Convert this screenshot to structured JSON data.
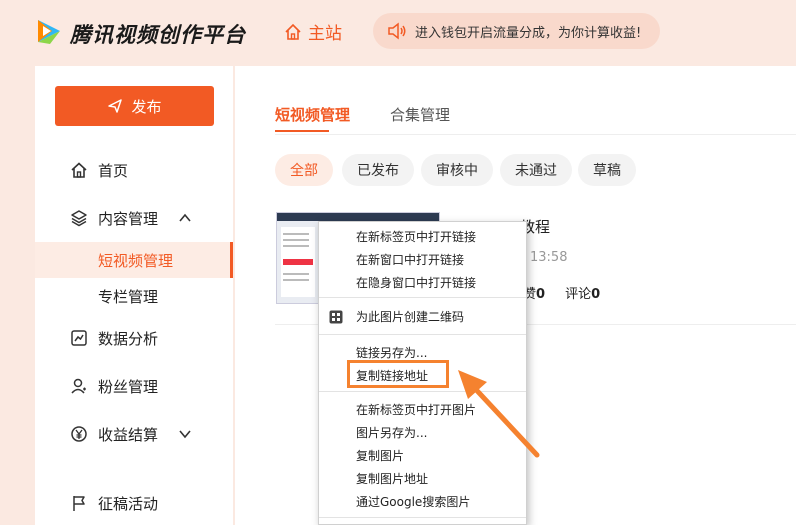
{
  "header": {
    "brand": "腾讯视频创作平台",
    "home_label": "主站",
    "notice": "进入钱包开启流量分成，为你计算收益!",
    "logo_icon": "tencent-video-logo",
    "home_icon": "home-icon",
    "speaker_icon": "speaker-icon"
  },
  "sidebar": {
    "publish_label": "发布",
    "items": [
      {
        "label": "首页",
        "icon": "home-icon"
      },
      {
        "label": "内容管理",
        "icon": "layers-icon"
      },
      {
        "label": "短视频管理"
      },
      {
        "label": "专栏管理"
      },
      {
        "label": "数据分析",
        "icon": "chart-icon"
      },
      {
        "label": "粉丝管理",
        "icon": "fans-icon"
      },
      {
        "label": "收益结算",
        "icon": "yuan-icon"
      },
      {
        "label": "征稿活动",
        "icon": "flag-icon"
      }
    ]
  },
  "main": {
    "tabs": [
      {
        "label": "短视频管理"
      },
      {
        "label": "合集管理"
      }
    ],
    "filters": [
      {
        "label": "全部"
      },
      {
        "label": "已发布"
      },
      {
        "label": "审核中"
      },
      {
        "label": "未通过"
      },
      {
        "label": "草稿"
      }
    ],
    "video": {
      "title_fragment": "教程",
      "time_fragment": "13:58",
      "likes_label": "赞",
      "likes_value": "0",
      "comments_label": "评论",
      "comments_value": "0"
    }
  },
  "context_menu": {
    "items": [
      "在新标签页中打开链接",
      "在新窗口中打开链接",
      "在隐身窗口中打开链接",
      "为此图片创建二维码",
      "链接另存为...",
      "复制链接地址",
      "在新标签页中打开图片",
      "图片另存为...",
      "复制图片",
      "复制图片地址",
      "通过Google搜索图片"
    ]
  },
  "colors": {
    "accent": "#f25a24",
    "annotation": "#f5822f",
    "background": "#fbe9e1"
  }
}
